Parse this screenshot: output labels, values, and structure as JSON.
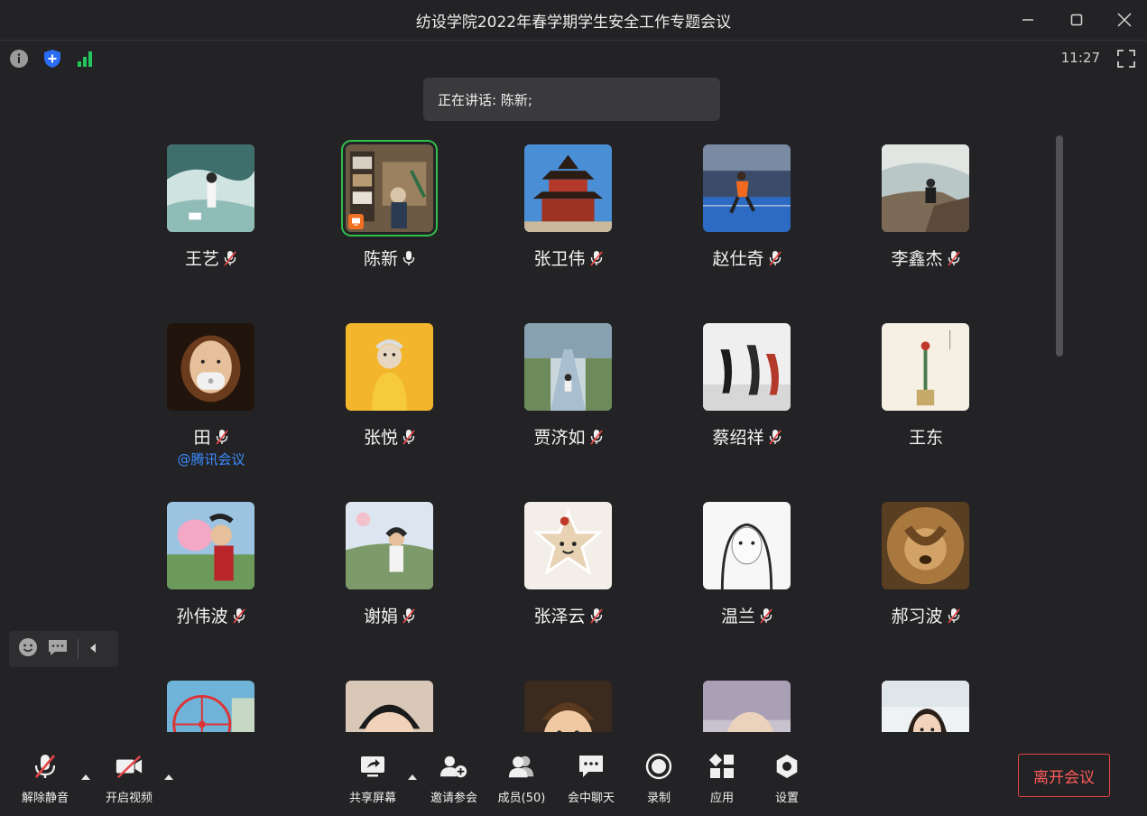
{
  "window": {
    "title": "纺设学院2022年春学期学生安全工作专题会议"
  },
  "status": {
    "time": "11:27"
  },
  "speaker": {
    "text": "正在讲话: 陈新;"
  },
  "participants": [
    {
      "name": "王艺",
      "mic": "muted",
      "avatar": "watercolor-girl-dog"
    },
    {
      "name": "陈新",
      "mic": "on",
      "avatar": "cafe-shelves",
      "speaking": true
    },
    {
      "name": "张卫伟",
      "mic": "muted",
      "avatar": "chinese-pagoda"
    },
    {
      "name": "赵仕奇",
      "mic": "muted",
      "avatar": "badminton-court"
    },
    {
      "name": "李鑫杰",
      "mic": "muted",
      "avatar": "cliff-sitter"
    },
    {
      "name": "田",
      "mic": "muted",
      "avatar": "masked-doll",
      "tag": "@腾讯会议"
    },
    {
      "name": "张悦",
      "mic": "muted",
      "avatar": "yellow-figure"
    },
    {
      "name": "贾济如",
      "mic": "muted",
      "avatar": "child-on-path"
    },
    {
      "name": "蔡绍祥",
      "mic": "muted",
      "avatar": "modern-chairs"
    },
    {
      "name": "王东",
      "mic": "none",
      "avatar": "ink-painting"
    },
    {
      "name": "孙伟波",
      "mic": "muted",
      "avatar": "boy-cotton-candy"
    },
    {
      "name": "谢娟",
      "mic": "muted",
      "avatar": "girl-flowers"
    },
    {
      "name": "张泽云",
      "mic": "muted",
      "avatar": "flower-cookie"
    },
    {
      "name": "温兰",
      "mic": "muted",
      "avatar": "sketch-girl"
    },
    {
      "name": "郝习波",
      "mic": "muted",
      "avatar": "lion"
    },
    {
      "name": "",
      "mic": "none",
      "avatar": "ferris-wheel"
    },
    {
      "name": "",
      "mic": "none",
      "avatar": "toddler"
    },
    {
      "name": "",
      "mic": "none",
      "avatar": "boy-smiling"
    },
    {
      "name": "",
      "mic": "none",
      "avatar": "blurred-face"
    },
    {
      "name": "",
      "mic": "none",
      "avatar": "woman-office"
    }
  ],
  "toolbar": {
    "unmute": "解除静音",
    "start_video": "开启视频",
    "share_screen": "共享屏幕",
    "invite": "邀请参会",
    "members": "成员(50)",
    "chat": "会中聊天",
    "record": "录制",
    "apps": "应用",
    "settings": "设置",
    "leave": "离开会议"
  },
  "colors": {
    "background": "#232325",
    "speaking_border": "#2fbf4b",
    "leave_red": "#e54545",
    "shield_blue": "#2a6df4",
    "signal_green": "#22c55e",
    "mention_blue": "#3b8bff",
    "share_orange": "#f27022"
  }
}
